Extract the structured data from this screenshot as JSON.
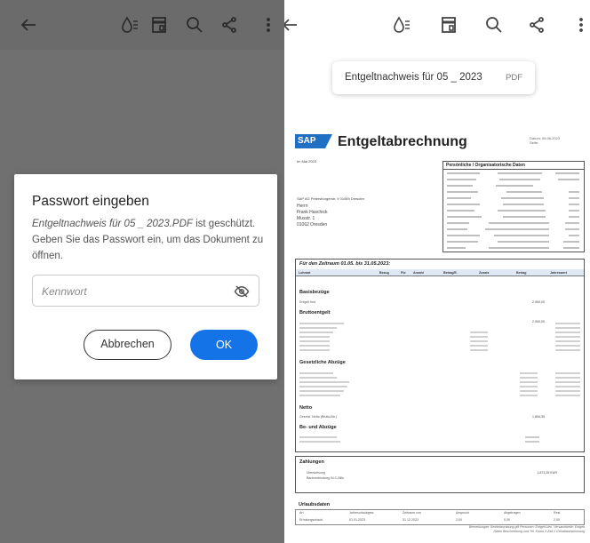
{
  "left": {
    "dialog": {
      "title": "Passwort eingeben",
      "filename": "Entgeltnachweis für 05 _ 2023.PDF",
      "message_rest": " ist geschützt. Geben Sie das Passwort ein, um das Dokument zu öffnen.",
      "password_placeholder": "Kennwort",
      "cancel_label": "Abbrechen",
      "ok_label": "OK"
    }
  },
  "right": {
    "file_title": "Entgeltnachweis für 05 _ 2023",
    "file_type": "PDF",
    "document": {
      "logo_text": "SAP",
      "title": "Entgeltabrechnung",
      "date_label": "Datum: 06.06.2023",
      "page_label": "Seite:",
      "sender_small": "Im Mai 2023",
      "company_line": "SAP AG Petersburgerstr. 9  01069 Dresden",
      "recipient": [
        "Herrn",
        "Frank Haschick",
        "Musstr. 1",
        "01062 Dresden"
      ],
      "personal_header": "Persönliche / Organisatorische Daten",
      "period": "Für den Zeitraum 01.05. bis 31.05.2023:",
      "columns": [
        "Lohnart",
        "Bezug",
        "Für",
        "Anzahl",
        "Betrag/E.",
        "Zusatz",
        "Betrag",
        "Jahreswert"
      ],
      "sections": [
        "Basisbezüge",
        "Bruttoentgelt",
        "Gesetzliche Abzüge",
        "Netto",
        "Be- und Abzüge",
        "Zahlungen",
        "Urlaubsdaten"
      ],
      "basis_line": "Entgelt fest",
      "basis_amount": "2.900,00",
      "brutto_amount": "2.900,00",
      "netto_line": "Gesetzl. Netto (Brutto/Ab.)",
      "netto_amount": "1.894,35",
      "zahlung_line_1": "Überweisung",
      "zahlung_line_2": "Bankverbindung IN.C-Bills",
      "zahlung_amount": "1.873,35  EUR",
      "urlaub_headers": [
        "Art",
        "Jahresurlaubgew.",
        "Zeitraum von",
        "Anspruch",
        "Abgetragen",
        "Rest"
      ],
      "urlaub_row": [
        "Erholungsurlaub",
        "01.01.2023",
        "31.12.2023",
        "2,00",
        "0,00",
        "2,00"
      ],
      "footer": "Bemerkungen: Betriebsordnung gilt Personen: Entgelt-Verl. Versandstelle: Entgelt Daten Beschreibung und Tel. Konto 3 Zeit 1 Gehaltsbestimmung"
    }
  }
}
